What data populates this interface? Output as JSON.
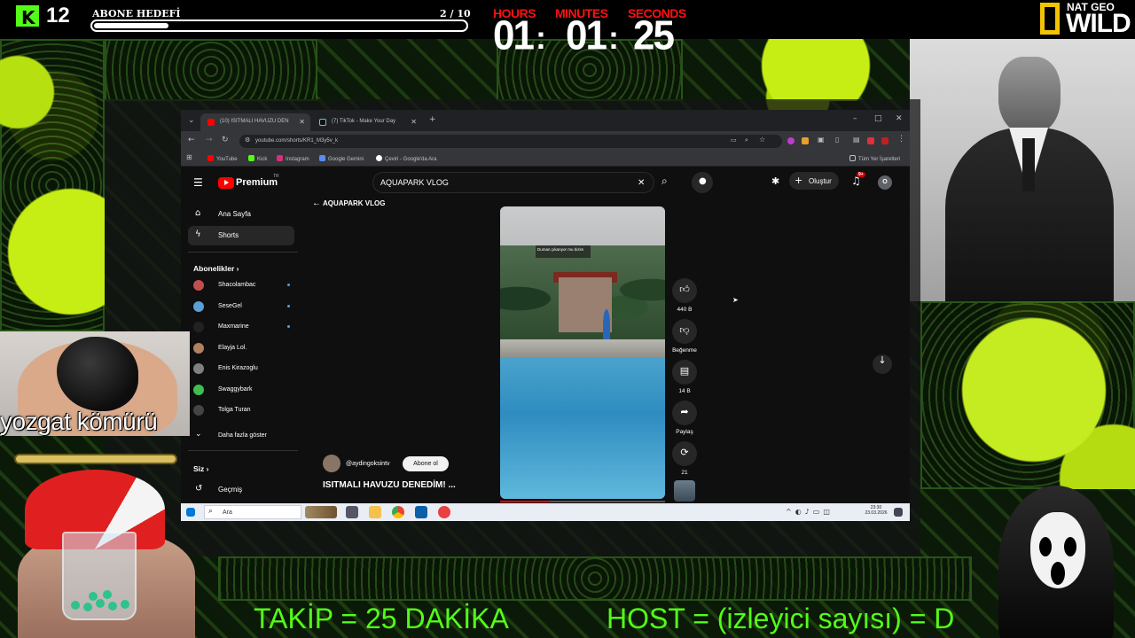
{
  "overlay": {
    "kick_count": "12",
    "goal_title": "ABONE HEDEFİ",
    "goal_count": "2 / 10",
    "goal_fraction": 0.2,
    "timer": {
      "hours_label": "HOURS",
      "minutes_label": "MINUTES",
      "seconds_label": "SECONDS",
      "hours": "01",
      "minutes": "01",
      "seconds": "25",
      "separator": ":"
    },
    "natgeo_top": "NAT GEO",
    "natgeo_wild": "WILD",
    "coal_label": "yozgat kömürü",
    "ticker_1": "TAKİP = 25 DAKİKA",
    "ticker_2": "HOST = (izleyici sayısı) = D"
  },
  "browser": {
    "tabs": [
      {
        "label": "(10) ISITMALI HAVUZU DEN",
        "active": true
      },
      {
        "label": "(7) TikTok - Make Your Day",
        "active": false
      }
    ],
    "url": "youtube.com/shorts/KR1_M3y5v_k",
    "bookmarks": [
      "YouTube",
      "Kick",
      "Instagram",
      "Google Gemini",
      "Çeviri - Google'da Ara"
    ],
    "all_bookmarks": "Tüm Yer İşaretleri",
    "window_controls": [
      "–",
      "□",
      "✕"
    ]
  },
  "youtube": {
    "brand": "Premium",
    "region": "TR",
    "search_query": "AQUAPARK VLOG",
    "create_label": "Oluştur",
    "notifications": "9+",
    "account_initial": "O",
    "back_label": "AQUAPARK VLOG",
    "nav": [
      {
        "label": "Ana Sayfa",
        "icon": "home-icon"
      },
      {
        "label": "Shorts",
        "icon": "shorts-icon"
      }
    ],
    "subscriptions_title": "Abonelikler",
    "subscriptions": [
      {
        "name": "Shacolambac",
        "color": "#c0504d",
        "dot": true
      },
      {
        "name": "SeseGel",
        "color": "#5aa0d8",
        "dot": true
      },
      {
        "name": "Maxmarine",
        "color": "#222222",
        "dot": true
      },
      {
        "name": "Elayja Lol.",
        "color": "#b08060",
        "dot": false
      },
      {
        "name": "Enis Kirazoglu",
        "color": "#808080",
        "dot": false
      },
      {
        "name": "Swaggybark",
        "color": "#3fbf4f",
        "dot": false
      },
      {
        "name": "Tolga Turan",
        "color": "#444444",
        "dot": false
      }
    ],
    "show_more": "Daha fazla göster",
    "you_title": "Siz",
    "history_label": "Geçmiş",
    "short": {
      "overlay_text": "Duman çıkarıyor mu bizim",
      "channel": "@aydingoksintv",
      "subscribe": "Abone ol",
      "title": "ISITMALI HAVUZU DENEDİM! ...",
      "likes": "440 B",
      "dislike_label": "Beğenme",
      "comments": "14 B",
      "share_label": "Paylaş",
      "remix_count": "21",
      "progress": 0.3
    }
  },
  "taskbar": {
    "search_placeholder": "Ara",
    "time": "23:30",
    "date": "23.03.2026"
  }
}
